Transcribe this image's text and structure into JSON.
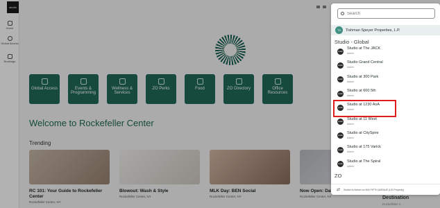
{
  "rail": {
    "logo": "studio",
    "home": "Home",
    "global_access": "Global Access",
    "bookings": "Bookings"
  },
  "tiles": [
    {
      "label": "Global Access"
    },
    {
      "label": "Events & Programming"
    },
    {
      "label": "Wellness & Services"
    },
    {
      "label": "ZO Perks"
    },
    {
      "label": "Food"
    },
    {
      "label": "ZO Directory"
    },
    {
      "label": "Office Resources"
    }
  ],
  "welcome": "Welcome to Rockefeller Center",
  "trending_label": "Trending",
  "cards": [
    {
      "title": "RC 101: Your Guide to Rockefeller Center",
      "location": "Rockefeller Center, NY"
    },
    {
      "title": "Blowout: Wash & Style",
      "location": "Rockefeller Center, NY"
    },
    {
      "title": "MLK Day: BEN Social",
      "location": "Rockefeller Center, NY"
    },
    {
      "title": "Now Open: Dall",
      "location": "Rockefeller Center, NY"
    }
  ],
  "peek_card_title": "Destination",
  "peek_card_loc": "Rockefeller C",
  "dropdown": {
    "search_placeholder": "Search",
    "selected_badge": "TS",
    "selected_name": "Tishman Speyer Properties, L.P.",
    "section_studio": "Studio - Global",
    "section_zo": "ZO",
    "items": [
      {
        "name": "Studio at The JACK",
        "role": "Admin"
      },
      {
        "name": "Studio Grand Central",
        "role": "Admin"
      },
      {
        "name": "Studio at 300 Park",
        "role": "Admin"
      },
      {
        "name": "Studio at 600 5th",
        "role": "Admin"
      },
      {
        "name": "Studio at 1230 AoA",
        "role": "Admin"
      },
      {
        "name": "Studio at 11 West",
        "role": "Admin"
      },
      {
        "name": "Studio at CitySpire",
        "role": "Admin"
      },
      {
        "name": "Studio at 175 Varick",
        "role": "Admin"
      },
      {
        "name": "Studio at The Spiral",
        "role": "Admin"
      }
    ],
    "item_avatar": "studio",
    "footer_text": "Switch to Admin on 600 FIFTH AVENUE (US Property)"
  },
  "colors": {
    "brand_green": "#1f6b56",
    "highlight": "#e01b1b"
  }
}
